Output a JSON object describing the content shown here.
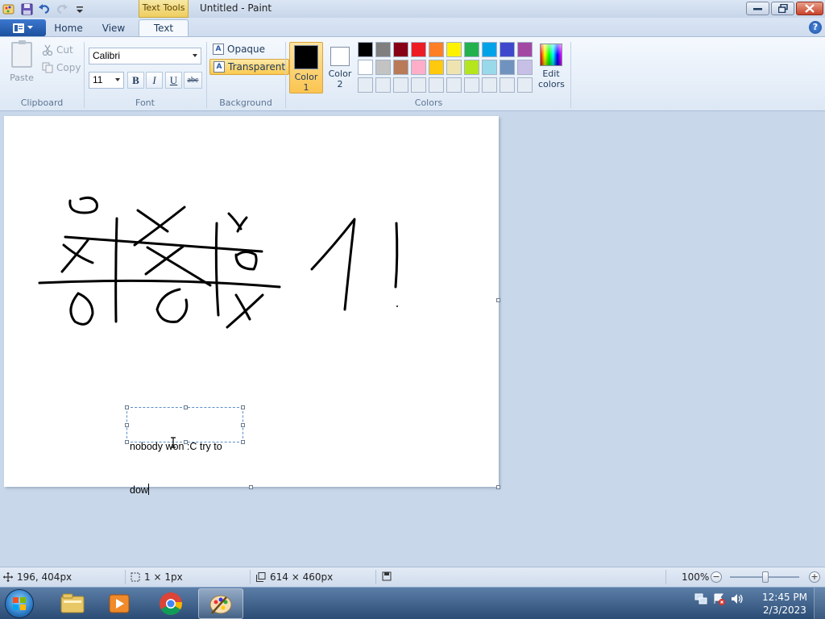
{
  "window": {
    "title": "Untitled - Paint",
    "contextual_tab": "Text Tools"
  },
  "tabs": {
    "home": "Home",
    "view": "View",
    "text": "Text"
  },
  "help_label": "?",
  "clipboard": {
    "paste": "Paste",
    "cut": "Cut",
    "copy": "Copy",
    "label": "Clipboard"
  },
  "font": {
    "family": "Calibri",
    "size": "11",
    "bold": "B",
    "italic": "I",
    "underline": "U",
    "strikethrough": "abc",
    "label": "Font"
  },
  "background": {
    "opaque": "Opaque",
    "transparent": "Transparent",
    "label": "Background",
    "active": "transparent"
  },
  "colors": {
    "color1_label_a": "Color",
    "color1_label_b": "1",
    "color2_label_a": "Color",
    "color2_label_b": "2",
    "color1": "#000000",
    "color2": "#ffffff",
    "edit_a": "Edit",
    "edit_b": "colors",
    "label": "Colors",
    "palette_row1": [
      "#000000",
      "#7f7f7f",
      "#880015",
      "#ed1c24",
      "#ff7f27",
      "#fff200",
      "#22b14c",
      "#00a2e8",
      "#3f48cc",
      "#a349a4"
    ],
    "palette_row2": [
      "#ffffff",
      "#c3c3c3",
      "#b97a57",
      "#ffaec9",
      "#ffc90e",
      "#efe4b0",
      "#b5e61d",
      "#99d9ea",
      "#7092be",
      "#c8bfe7"
    ],
    "palette_row3": [
      "#e6ecf4",
      "#e6ecf4",
      "#e6ecf4",
      "#e6ecf4",
      "#e6ecf4",
      "#e6ecf4",
      "#e6ecf4",
      "#e6ecf4",
      "#e6ecf4",
      "#e6ecf4"
    ]
  },
  "canvas": {
    "text_line1": "nobody won :C try to",
    "text_line2": "dow"
  },
  "status": {
    "cursor_pos": "196, 404px",
    "selection_size": "1 × 1px",
    "canvas_size": "614 × 460px",
    "zoom": "100%",
    "zoom_minus": "−",
    "zoom_plus": "+"
  },
  "taskbar": {
    "time": "12:45 PM",
    "date": "2/3/2023"
  }
}
